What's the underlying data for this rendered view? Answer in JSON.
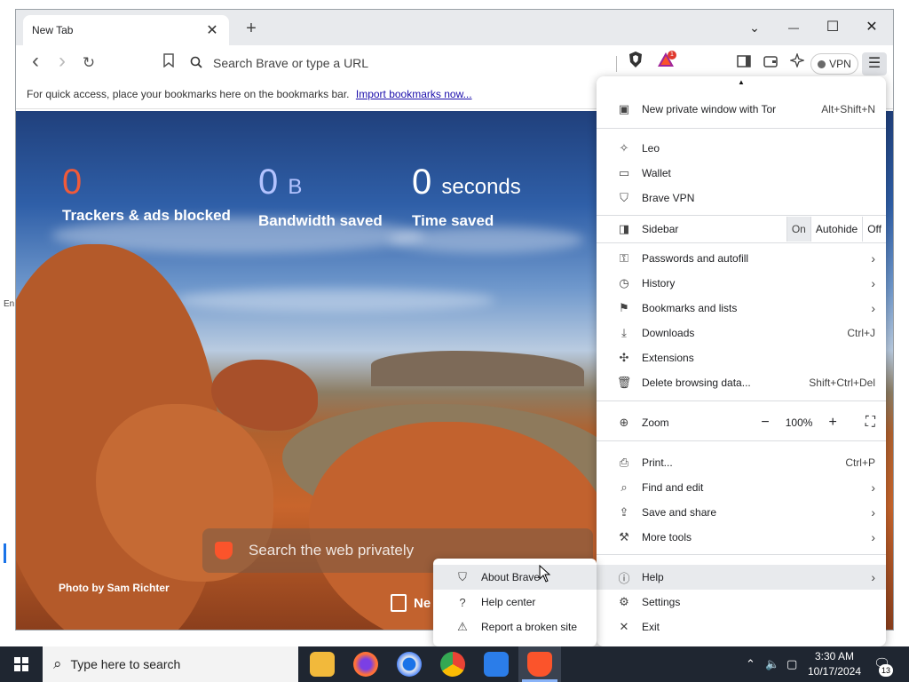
{
  "window": {
    "tab_title": "New Tab",
    "tab_close": "✕",
    "new_tab": "+",
    "controls": {
      "dropdown": "⌄",
      "minimize": "—",
      "maximize": "☐",
      "close": "✕"
    }
  },
  "toolbar": {
    "back": "‹",
    "forward": "›",
    "reload": "↻",
    "bookmark": "⚲",
    "omnibox_placeholder": "Search Brave or type a URL",
    "rewards_badge": "1",
    "vpn_label": "VPN",
    "menu": "☰"
  },
  "bookmarks_bar": {
    "hint": "For quick access, place your bookmarks here on the bookmarks bar.",
    "import_link": "Import bookmarks now..."
  },
  "ntp": {
    "stats": [
      {
        "value": "0",
        "unit": "",
        "label": "Trackers & ads blocked",
        "color": "#f05a3a"
      },
      {
        "value": "0",
        "unit": "B",
        "label": "Bandwidth saved",
        "color": "#b3c3ff"
      },
      {
        "value": "0",
        "unit": "seconds",
        "label": "Time saved",
        "color": "#ffffff"
      }
    ],
    "search_placeholder": "Search the web privately",
    "photo_credit": "Photo by Sam Richter",
    "news_label": "Ne"
  },
  "menu": {
    "scroll_up": "▲",
    "items": {
      "private_tor": {
        "label": "New private window with Tor",
        "shortcut": "Alt+Shift+N"
      },
      "leo": {
        "label": "Leo"
      },
      "wallet": {
        "label": "Wallet"
      },
      "brave_vpn": {
        "label": "Brave VPN"
      },
      "sidebar": {
        "label": "Sidebar",
        "options": [
          "On",
          "Autohide",
          "Off"
        ],
        "selected": "On"
      },
      "passwords": {
        "label": "Passwords and autofill"
      },
      "history": {
        "label": "History"
      },
      "bookmarks": {
        "label": "Bookmarks and lists"
      },
      "downloads": {
        "label": "Downloads",
        "shortcut": "Ctrl+J"
      },
      "extensions": {
        "label": "Extensions"
      },
      "delete_data": {
        "label": "Delete browsing data...",
        "shortcut": "Shift+Ctrl+Del"
      },
      "zoom": {
        "label": "Zoom",
        "minus": "−",
        "value": "100%",
        "plus": "+",
        "fullscreen": "⛶"
      },
      "print": {
        "label": "Print...",
        "shortcut": "Ctrl+P"
      },
      "find_edit": {
        "label": "Find and edit"
      },
      "save_share": {
        "label": "Save and share"
      },
      "more_tools": {
        "label": "More tools"
      },
      "help": {
        "label": "Help"
      },
      "settings": {
        "label": "Settings"
      },
      "exit": {
        "label": "Exit"
      }
    }
  },
  "help_submenu": {
    "items": [
      {
        "label": "About Brave"
      },
      {
        "label": "Help center"
      },
      {
        "label": "Report a broken site"
      }
    ]
  },
  "taskbar": {
    "search_placeholder": "Type here to search",
    "time": "3:30 AM",
    "date": "10/17/2024",
    "notifications": "13"
  },
  "desktop": {
    "fragment": "En"
  },
  "colors": {
    "brave_orange": "#fb542b",
    "taskbar": "#1f2631",
    "menu_hover": "#e8eaed"
  }
}
